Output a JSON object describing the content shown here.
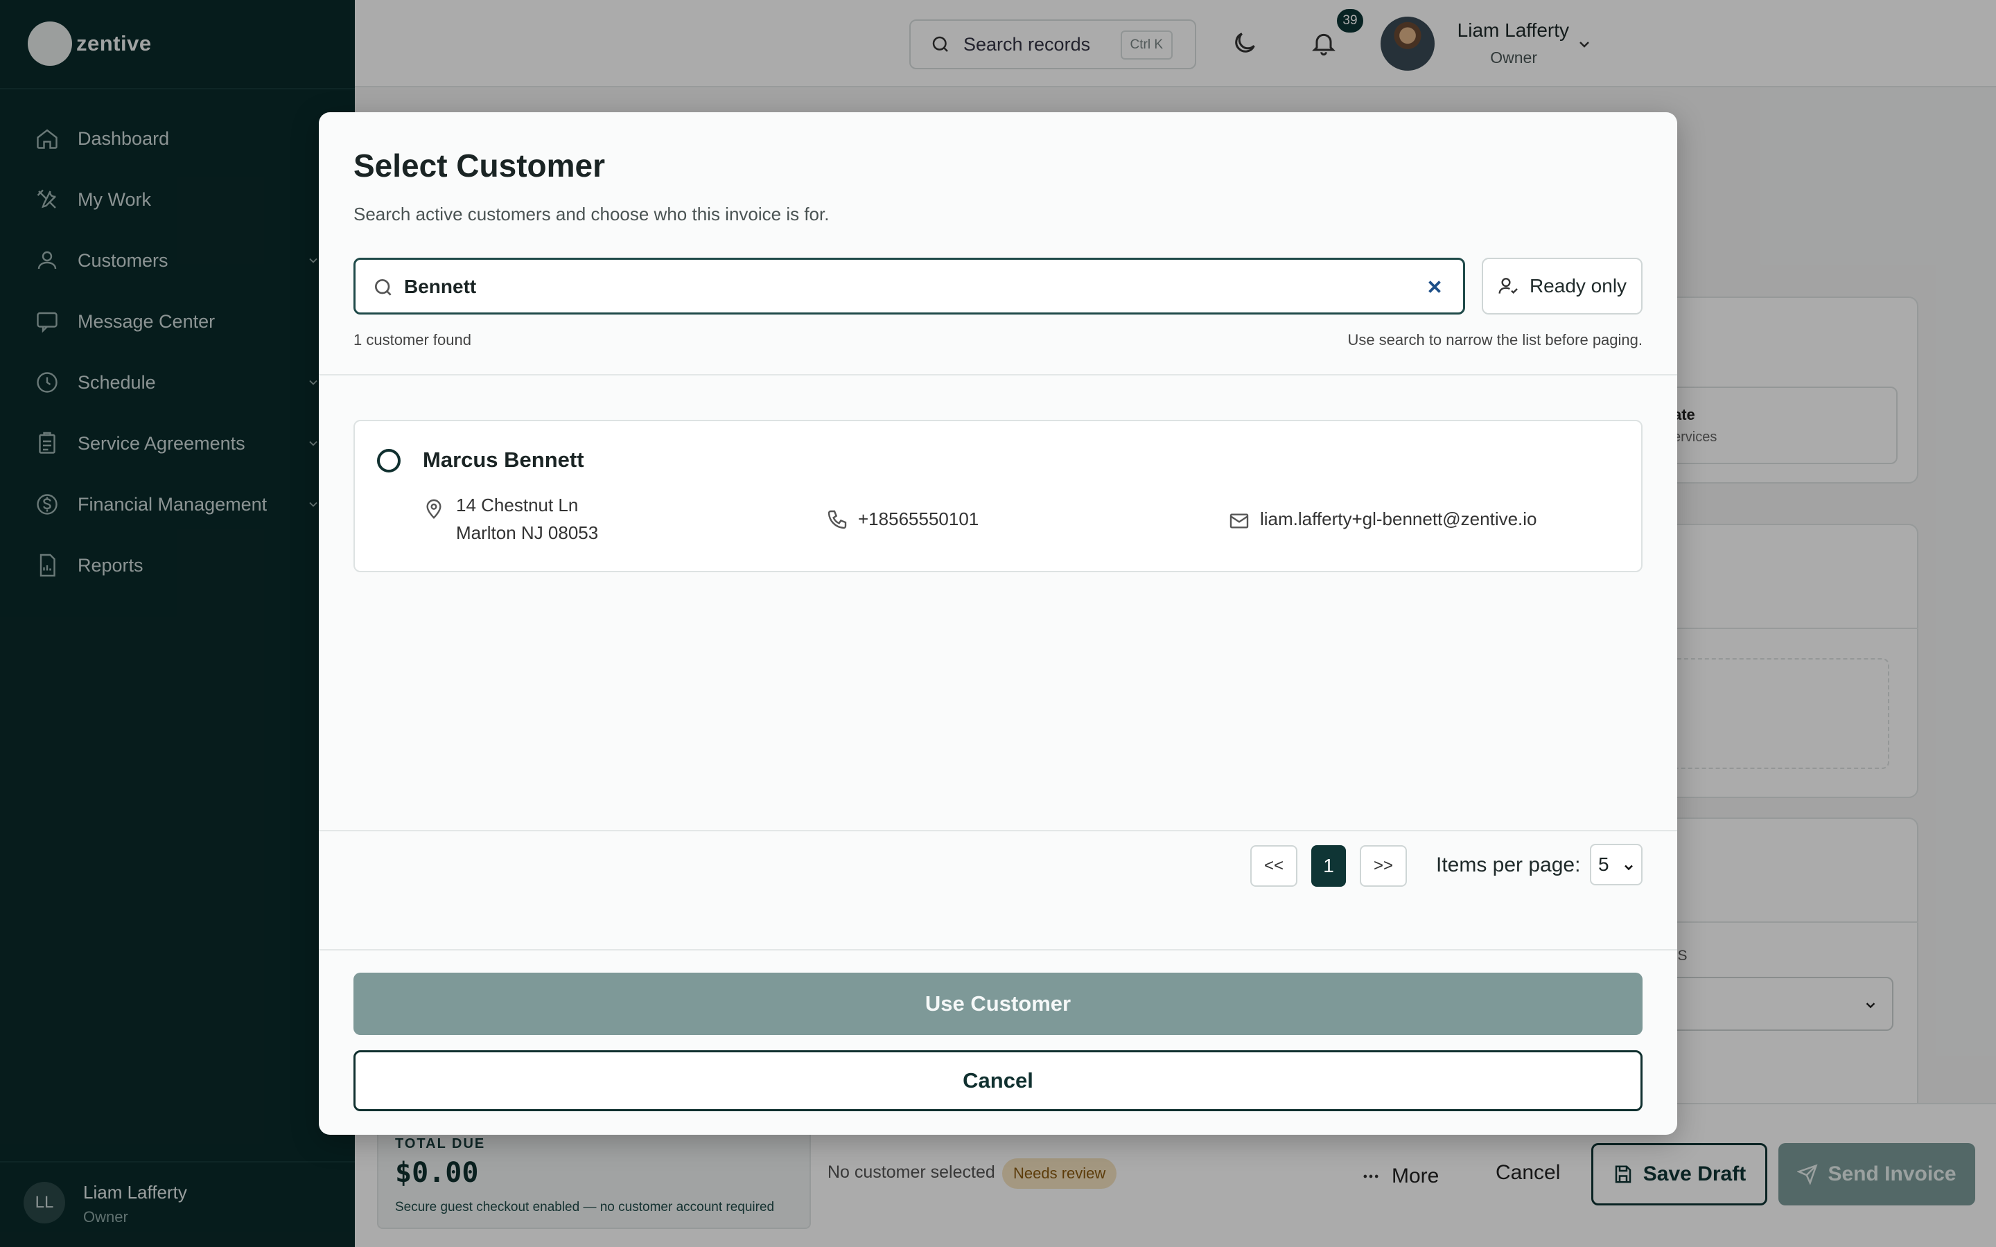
{
  "app": {
    "logo_text": "zentive"
  },
  "sidebar": {
    "items": [
      {
        "label": "Dashboard",
        "icon": "home-icon",
        "has_chevron": false
      },
      {
        "label": "My Work",
        "icon": "tools-icon",
        "has_chevron": false
      },
      {
        "label": "Customers",
        "icon": "users-icon",
        "has_chevron": true
      },
      {
        "label": "Message Center",
        "icon": "chat-icon",
        "has_chevron": false
      },
      {
        "label": "Schedule",
        "icon": "clock-icon",
        "has_chevron": true
      },
      {
        "label": "Service Agreements",
        "icon": "clipboard-icon",
        "has_chevron": true
      },
      {
        "label": "Financial Management",
        "icon": "dollar-icon",
        "has_chevron": true
      },
      {
        "label": "Reports",
        "icon": "report-icon",
        "has_chevron": false
      }
    ],
    "user": {
      "initials": "LL",
      "name": "Liam Lafferty",
      "role": "Owner"
    }
  },
  "header": {
    "search_placeholder": "Search records",
    "shortcut": "Ctrl K",
    "notifications_count": "39",
    "user_name": "Liam Lafferty",
    "user_role": "Owner"
  },
  "background": {
    "rate_label": "ate",
    "services_label": "ervices",
    "ms_label": "MS"
  },
  "bottom_bar": {
    "total_label": "TOTAL DUE",
    "total_value": "$0.00",
    "total_note": "Secure guest checkout enabled — no customer account required",
    "customer_status": "No customer selected",
    "review_badge": "Needs review",
    "more_label": "More",
    "cancel_label": "Cancel",
    "save_label": "Save Draft",
    "send_label": "Send Invoice"
  },
  "modal": {
    "title": "Select Customer",
    "subtitle": "Search active customers and choose who this invoice is for.",
    "search_value": "Bennett",
    "ready_only_label": "Ready only",
    "found_text": "1 customer found",
    "hint_text": "Use search to narrow the list before paging.",
    "customers": [
      {
        "name": "Marcus Bennett",
        "address_line1": "14 Chestnut Ln",
        "address_line2": "Marlton NJ 08053",
        "phone": "+18565550101",
        "email": "liam.lafferty+gl-bennett@zentive.io"
      }
    ],
    "pager": {
      "prev": "<<",
      "current": "1",
      "next": ">>"
    },
    "items_per_page_label": "Items per page:",
    "items_per_page_value": "5",
    "use_button": "Use Customer",
    "cancel_button": "Cancel"
  },
  "colors": {
    "sidebar_bg": "#0a2a2a",
    "primary": "#0f3535",
    "disabled_primary": "#7e9998",
    "badge_warning_bg": "#f5e3c1"
  }
}
